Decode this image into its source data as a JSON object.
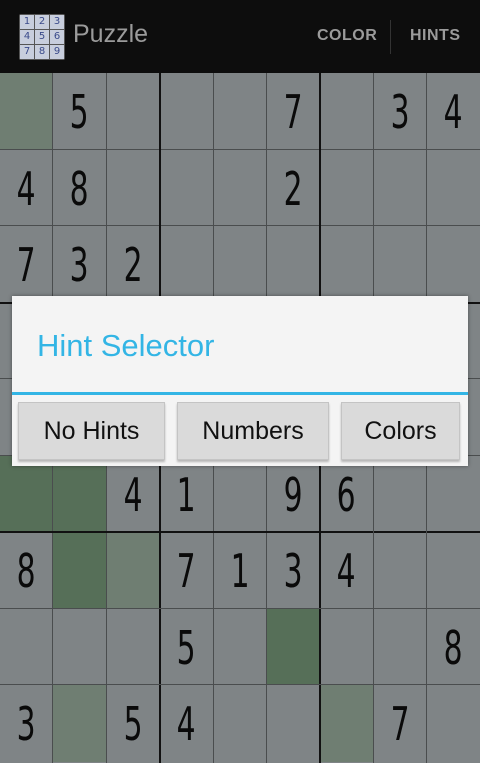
{
  "actionbar": {
    "title": "Puzzle",
    "icon_digits": [
      "1",
      "2",
      "3",
      "4",
      "5",
      "6",
      "7",
      "8",
      "9"
    ],
    "color_label": "COLOR",
    "hints_label": "HINTS"
  },
  "board": {
    "rows": [
      [
        "",
        "5",
        "",
        "",
        "",
        "7",
        "",
        "3",
        "4"
      ],
      [
        "4",
        "8",
        "",
        "",
        "",
        "2",
        "",
        "",
        ""
      ],
      [
        "7",
        "3",
        "2",
        "",
        "",
        "",
        "",
        "",
        ""
      ],
      [
        "",
        "",
        "",
        "",
        "",
        "",
        "",
        "",
        ""
      ],
      [
        "",
        "",
        "",
        "",
        "",
        "",
        "",
        "",
        ""
      ],
      [
        "",
        "",
        "4",
        "1",
        "",
        "9",
        "6",
        "",
        ""
      ],
      [
        "8",
        "",
        "",
        "7",
        "1",
        "3",
        "4",
        "",
        ""
      ],
      [
        "",
        "",
        "",
        "5",
        "",
        "",
        "",
        "",
        "8"
      ],
      [
        "3",
        "",
        "5",
        "4",
        "",
        "",
        "",
        "7",
        ""
      ]
    ],
    "highlight_color": "#5f7a62"
  },
  "dialog": {
    "title": "Hint Selector",
    "accent_color": "#33b5e5",
    "buttons": [
      "No Hints",
      "Numbers",
      "Colors"
    ]
  }
}
